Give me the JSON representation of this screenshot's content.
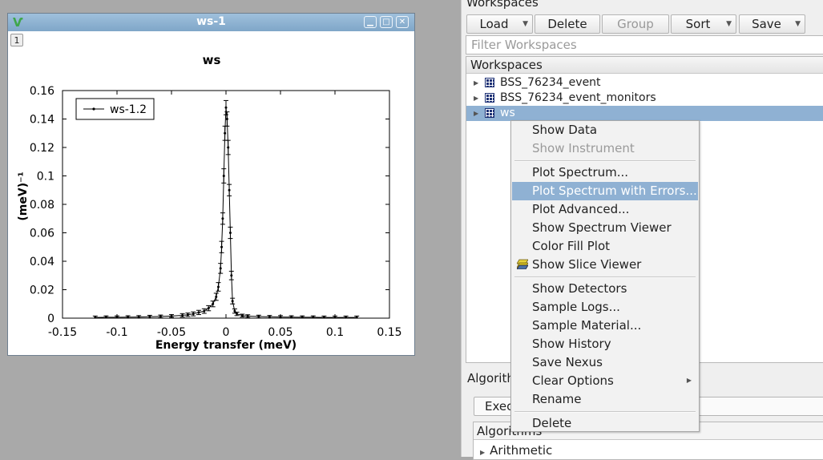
{
  "plot_window": {
    "title": "ws-1",
    "page_tab": "1",
    "buttons": {
      "minimize": "minimize-icon",
      "maximize": "maximize-icon",
      "close": "close-icon"
    }
  },
  "right_panel": {
    "header": "Workspaces",
    "toolbar": {
      "load": "Load",
      "delete": "Delete",
      "group": "Group",
      "sort": "Sort",
      "save": "Save"
    },
    "filter_placeholder": "Filter Workspaces",
    "tree_header": "Workspaces",
    "workspaces": [
      {
        "name": "BSS_76234_event",
        "selected": false
      },
      {
        "name": "BSS_76234_event_monitors",
        "selected": false
      },
      {
        "name": "ws",
        "selected": true
      }
    ],
    "algorithms_header": "Algorith",
    "execute_label": "Execu",
    "algo_tree_header": "Algorithms",
    "algo_item": "Arithmetic"
  },
  "context_menu": {
    "items": [
      {
        "label": "Show Data",
        "disabled": false
      },
      {
        "label": "Show Instrument",
        "disabled": true
      },
      {
        "label": "Plot Spectrum...",
        "disabled": false
      },
      {
        "label": "Plot Spectrum with Errors...",
        "disabled": false,
        "highlighted": true
      },
      {
        "label": "Plot Advanced...",
        "disabled": false
      },
      {
        "label": "Show Spectrum Viewer",
        "disabled": false
      },
      {
        "label": "Color Fill Plot",
        "disabled": false
      },
      {
        "label": "Show Slice Viewer",
        "disabled": false
      },
      {
        "label": "Show Detectors",
        "disabled": false
      },
      {
        "label": "Sample Logs...",
        "disabled": false
      },
      {
        "label": "Sample Material...",
        "disabled": false
      },
      {
        "label": "Show History",
        "disabled": false
      },
      {
        "label": "Save Nexus",
        "disabled": false
      },
      {
        "label": "Clear Options",
        "disabled": false,
        "submenu": true
      },
      {
        "label": "Rename",
        "disabled": false
      },
      {
        "label": "Delete",
        "disabled": false
      }
    ]
  },
  "chart_data": {
    "type": "line",
    "title": "ws",
    "xlabel": "Energy transfer (meV)",
    "ylabel": "(meV)⁻¹",
    "xlim": [
      -0.15,
      0.15
    ],
    "ylim": [
      0,
      0.16
    ],
    "xticks": [
      -0.15,
      -0.1,
      -0.05,
      0,
      0.05,
      0.1,
      0.15
    ],
    "xtick_labels": [
      "-0.15",
      "-0.1",
      "-0.05",
      "0",
      "0.05",
      "0.1",
      "0.15"
    ],
    "yticks": [
      0,
      0.02,
      0.04,
      0.06,
      0.08,
      0.1,
      0.12,
      0.14,
      0.16
    ],
    "ytick_labels": [
      "0",
      "0.02",
      "0.04",
      "0.06",
      "0.08",
      "0.1",
      "0.12",
      "0.14",
      "0.16"
    ],
    "grid": false,
    "legend_position": "top-left",
    "series": [
      {
        "name": "ws-1.2",
        "color": "#000000",
        "error_bars": true,
        "x": [
          -0.12,
          -0.11,
          -0.1,
          -0.09,
          -0.08,
          -0.07,
          -0.06,
          -0.05,
          -0.04,
          -0.035,
          -0.03,
          -0.025,
          -0.02,
          -0.016,
          -0.012,
          -0.009,
          -0.007,
          -0.005,
          -0.004,
          -0.003,
          -0.002,
          -0.001,
          0,
          0.001,
          0.002,
          0.003,
          0.004,
          0.005,
          0.006,
          0.008,
          0.01,
          0.015,
          0.02,
          0.03,
          0.04,
          0.05,
          0.06,
          0.07,
          0.08,
          0.09,
          0.1,
          0.11,
          0.12
        ],
        "y": [
          0.0005,
          0.0006,
          0.0006,
          0.0007,
          0.0008,
          0.001,
          0.0012,
          0.0015,
          0.002,
          0.0024,
          0.003,
          0.004,
          0.005,
          0.007,
          0.01,
          0.015,
          0.022,
          0.035,
          0.05,
          0.07,
          0.1,
          0.13,
          0.148,
          0.14,
          0.12,
          0.09,
          0.06,
          0.03,
          0.012,
          0.005,
          0.003,
          0.0018,
          0.0014,
          0.0011,
          0.0009,
          0.0008,
          0.0007,
          0.0006,
          0.0006,
          0.0005,
          0.0005,
          0.0005,
          0.0005
        ],
        "err": [
          0.001,
          0.001,
          0.001,
          0.001,
          0.001,
          0.001,
          0.001,
          0.001,
          0.0012,
          0.0012,
          0.0014,
          0.0015,
          0.0016,
          0.0018,
          0.002,
          0.0025,
          0.003,
          0.0035,
          0.004,
          0.004,
          0.005,
          0.005,
          0.005,
          0.005,
          0.005,
          0.004,
          0.004,
          0.003,
          0.002,
          0.0015,
          0.0012,
          0.001,
          0.001,
          0.001,
          0.001,
          0.001,
          0.001,
          0.001,
          0.001,
          0.001,
          0.001,
          0.001,
          0.001
        ]
      }
    ]
  }
}
